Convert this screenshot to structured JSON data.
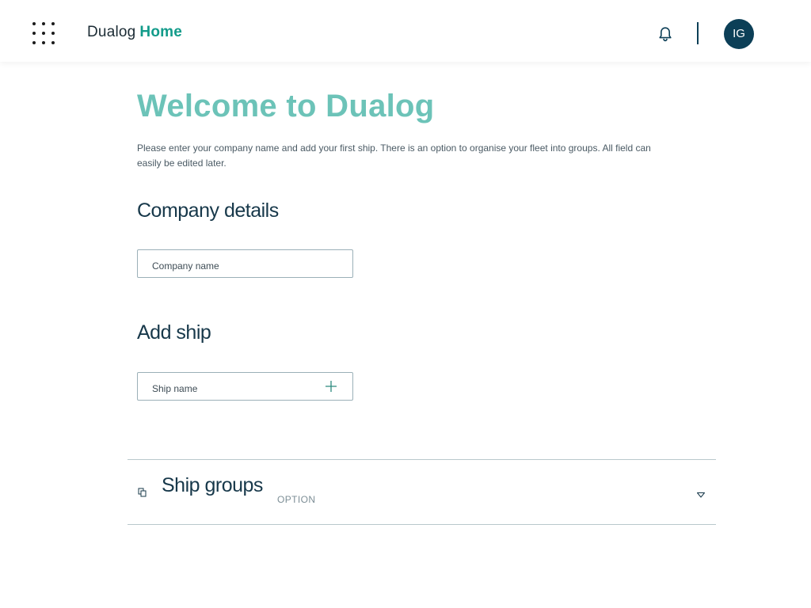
{
  "header": {
    "brand_name": "Dualog",
    "brand_product": "Home",
    "avatar_initials": "IG",
    "apps_icon": "apps-grid-icon",
    "bell_icon": "bell-icon"
  },
  "welcome": {
    "title": "Welcome to Dualog",
    "intro": "Please enter your company name and add your first ship. There is an option to organise your fleet into groups. All field can easily be edited later."
  },
  "company": {
    "heading": "Company details",
    "name_placeholder": "Company name",
    "name_value": ""
  },
  "ship": {
    "heading": "Add ship",
    "name_placeholder": "Ship name",
    "name_value": "",
    "add_icon": "plus-icon"
  },
  "groups": {
    "title": "Ship groups",
    "tag": "OPTION",
    "icon": "copy-icon",
    "chevron_icon": "chevron-down-icon"
  },
  "colors": {
    "accent": "#129b8a",
    "title_teal": "#6cc3b8",
    "navy": "#0c3f57",
    "heading": "#17384a"
  }
}
